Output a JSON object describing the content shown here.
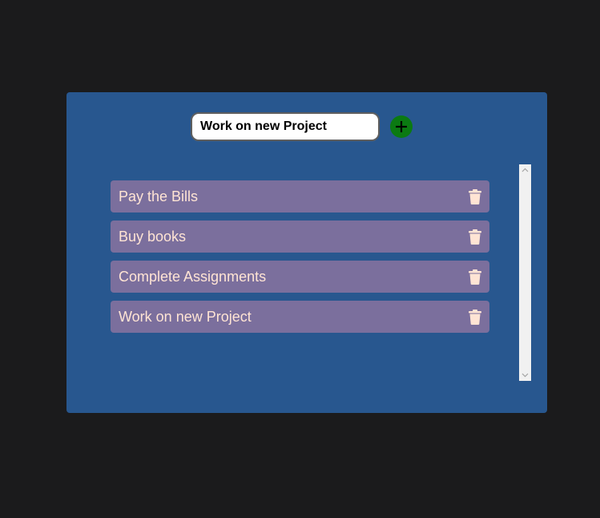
{
  "input": {
    "value": "Work on new Project",
    "placeholder": ""
  },
  "add_button": {
    "icon": "plus-icon"
  },
  "tasks": [
    {
      "label": "Pay the Bills",
      "icon": "trash-icon"
    },
    {
      "label": "Buy books",
      "icon": "trash-icon"
    },
    {
      "label": "Complete Assignments",
      "icon": "trash-icon"
    },
    {
      "label": "Work on new Project",
      "icon": "trash-icon"
    }
  ],
  "colors": {
    "page_background": "#1b1b1c",
    "card_background": "#28578f",
    "task_background": "#7b6f9d",
    "task_text": "#ffe4d4",
    "add_button": "#0b7a12"
  }
}
